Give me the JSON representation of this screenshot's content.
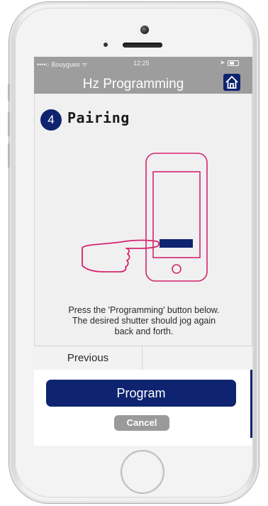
{
  "status_bar": {
    "carrier": "••••○ Bouygues ᯤ",
    "time": "12:25",
    "location_icon": "location-arrow-icon",
    "battery_icon": "battery-icon"
  },
  "header": {
    "title": "Hz Programming",
    "home_icon": "home-icon"
  },
  "step": {
    "number": "4",
    "label": "Pairing"
  },
  "illustration": {
    "name": "hand-pressing-phone-button",
    "outline_color": "#d6246e",
    "button_color": "#0f2470"
  },
  "instructions": {
    "line1": "Press the 'Programming' button below.",
    "line2": "The desired shutter should jog again",
    "line3": "back and forth."
  },
  "nav": {
    "previous_label": "Previous",
    "next_label": ""
  },
  "actions": {
    "program_label": "Program",
    "cancel_label": "Cancel"
  },
  "colors": {
    "accent": "#0f2470",
    "navbar": "#9d9d9d",
    "cancel": "#9a9a9a"
  }
}
